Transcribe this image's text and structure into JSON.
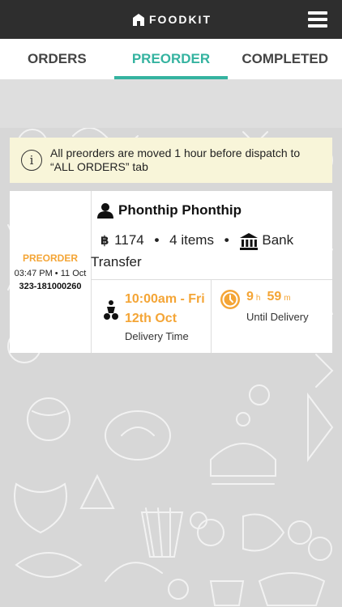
{
  "header": {
    "brand": "FOODKIT",
    "logo_icon": "home-logo-icon",
    "menu_icon": "hamburger-menu-icon"
  },
  "tabs": [
    {
      "label": "ORDERS",
      "active": false
    },
    {
      "label": "PREORDER",
      "active": true
    },
    {
      "label": "COMPLETED",
      "active": false
    }
  ],
  "colors": {
    "accent": "#35b3a0",
    "warning": "#f4a536",
    "topbar": "#2e2e2e",
    "notice_bg": "#f8f5d9"
  },
  "notice": {
    "icon": "info-icon",
    "icon_glyph": "i",
    "text": "All preorders are moved 1 hour before dispatch to “ALL ORDERS” tab"
  },
  "order": {
    "status": "PREORDER",
    "placed_at": "03:47 PM • 11 Oct",
    "order_id": "323-181000260",
    "customer": "Phonthip Phonthip",
    "currency_symbol": "฿",
    "total": "1174",
    "separator": "•",
    "items": "4 items",
    "payment": "Bank Transfer",
    "delivery_time": "10:00am - Fri 12th Oct",
    "delivery_label": "Delivery Time",
    "countdown": {
      "hours": "9",
      "hours_unit": "h",
      "minutes": "59",
      "minutes_unit": "m",
      "label": "Until Delivery"
    }
  }
}
